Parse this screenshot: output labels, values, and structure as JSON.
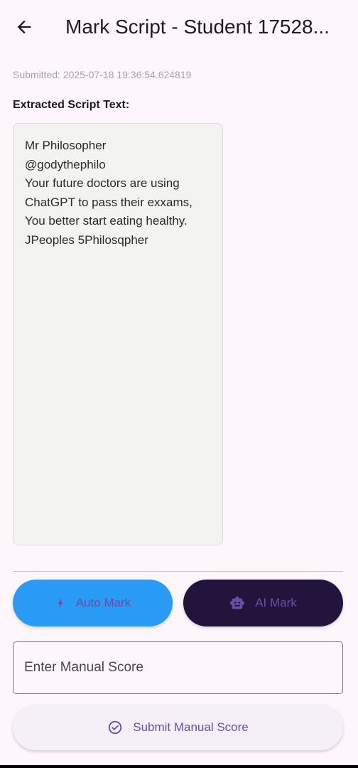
{
  "appbar": {
    "back_icon": "arrow-left-icon",
    "title": "Mark Script - Student 17528..."
  },
  "submitted": "Submitted: 2025-07-18 19:36:54.624819",
  "section_label": "Extracted Script Text:",
  "script_text": "Mr Philosopher\n@godythephilo\nYour future doctors are using\nChatGPT to pass their exxams,\nYou better start eating healthy.\nJPeoples 5Philosqpher",
  "buttons": {
    "auto_mark": {
      "label": "Auto Mark",
      "icon": "bolt-icon"
    },
    "ai_mark": {
      "label": "AI Mark",
      "icon": "robot-icon"
    },
    "submit": {
      "label": "Submit Manual Score",
      "icon": "check-circle-icon"
    }
  },
  "manual_score": {
    "placeholder": "Enter Manual Score",
    "value": ""
  },
  "colors": {
    "background": "#fdf7fc",
    "auto_mark_bg": "#2a9bf4",
    "ai_mark_bg": "#22143d",
    "accent": "#6750a4"
  }
}
